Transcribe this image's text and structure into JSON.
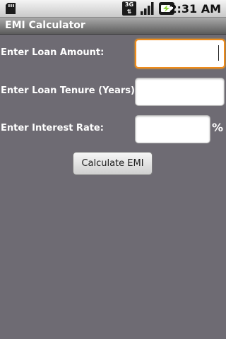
{
  "status_bar": {
    "network_type": "3G",
    "time": "2:31 AM"
  },
  "app": {
    "title": "EMI Calculator"
  },
  "form": {
    "loan_amount_label": "Enter Loan Amount:",
    "loan_amount_value": "",
    "loan_tenure_label": "Enter Loan Tenure (Years):",
    "loan_tenure_value": "",
    "interest_rate_label": "Enter Interest Rate:",
    "interest_rate_value": "",
    "interest_rate_unit": "%",
    "calculate_button_label": "Calculate EMI"
  },
  "colors": {
    "background": "#6e6b73",
    "focus_accent": "#f08c1b",
    "battery_accent": "#8fd63a"
  },
  "icons": [
    "sd-card-icon",
    "network-3g-icon",
    "signal-strength-icon",
    "battery-charging-icon"
  ]
}
